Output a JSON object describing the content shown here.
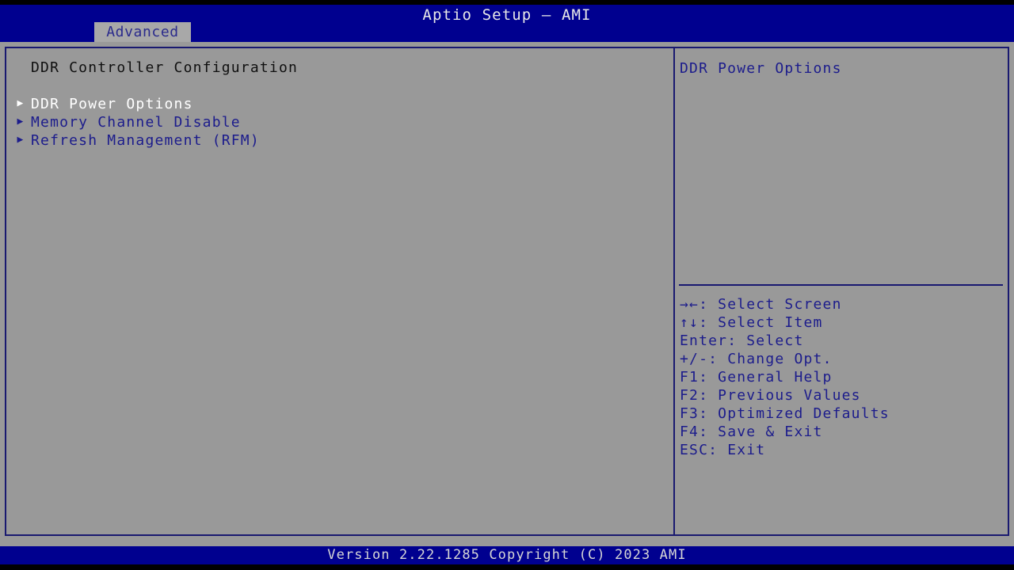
{
  "window": {
    "title": "Aptio Setup – AMI",
    "colors": {
      "background": "#999999",
      "header_blue": "#00008f",
      "border_blue": "#191970",
      "text_blue": "#1c1c8c",
      "selected_text": "#ffffff",
      "title_text": "#e8e8e8",
      "heading_text": "#101010"
    }
  },
  "menubar": {
    "tabs": [
      {
        "label": "Advanced",
        "active": true
      }
    ]
  },
  "left_panel": {
    "section_title": "DDR Controller Configuration",
    "items": [
      {
        "bullet": "right-triangle-icon",
        "label": "DDR Power Options",
        "selected": true
      },
      {
        "bullet": "right-triangle-icon",
        "label": "Memory Channel Disable",
        "selected": false
      },
      {
        "bullet": "right-triangle-icon",
        "label": "Refresh Management (RFM)",
        "selected": false
      }
    ]
  },
  "right_panel": {
    "help_text": "DDR Power Options",
    "legend": [
      {
        "keys": "→←",
        "text": ": Select Screen"
      },
      {
        "keys": "↑↓",
        "text": ": Select Item"
      },
      {
        "keys": "Enter",
        "text": ": Select"
      },
      {
        "keys": "+/-",
        "text": ": Change Opt."
      },
      {
        "keys": "F1",
        "text": ": General Help"
      },
      {
        "keys": "F2",
        "text": ": Previous Values"
      },
      {
        "keys": "F3",
        "text": ": Optimized Defaults"
      },
      {
        "keys": "F4",
        "text": ": Save & Exit"
      },
      {
        "keys": "ESC",
        "text": ": Exit"
      }
    ]
  },
  "footer": {
    "version_text": "Version 2.22.1285 Copyright (C) 2023 AMI"
  }
}
